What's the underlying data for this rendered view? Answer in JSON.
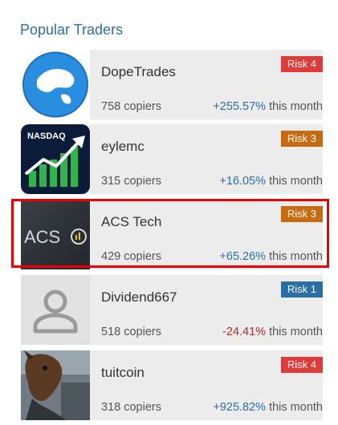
{
  "section": {
    "title": "Popular Traders"
  },
  "traders": [
    {
      "name": "DopeTrades",
      "risk": "Risk 4",
      "risk_color": "#e03b3b",
      "copiers": "758 copiers",
      "change": "+255.57%",
      "change_direction": "positive",
      "period": "this month",
      "avatar_icon": "globe-icon"
    },
    {
      "name": "eylemc",
      "risk": "Risk 3",
      "risk_color": "#c96a0f",
      "copiers": "315 copiers",
      "change": "+16.05%",
      "change_direction": "positive",
      "period": "this month",
      "avatar_icon": "nasdaq-chart-icon",
      "avatar_text": "NASDAQ"
    },
    {
      "name": "ACS Tech",
      "risk": "Risk 3",
      "risk_color": "#c96a0f",
      "copiers": "429 copiers",
      "change": "+65.26%",
      "change_direction": "positive",
      "period": "this month",
      "avatar_icon": "acs-logo-icon",
      "avatar_text": "ACS",
      "highlighted": true
    },
    {
      "name": "Dividend667",
      "risk": "Risk 1",
      "risk_color": "#2a6fa6",
      "copiers": "518 copiers",
      "change": "-24.41%",
      "change_direction": "negative",
      "period": "this month",
      "avatar_icon": "default-user-icon"
    },
    {
      "name": "tuitcoin",
      "risk": "Risk 4",
      "risk_color": "#e03b3b",
      "copiers": "318 copiers",
      "change": "+925.82%",
      "change_direction": "positive",
      "period": "this month",
      "avatar_icon": "horse-mask-photo-icon"
    }
  ],
  "highlight_color": "#ef0000"
}
